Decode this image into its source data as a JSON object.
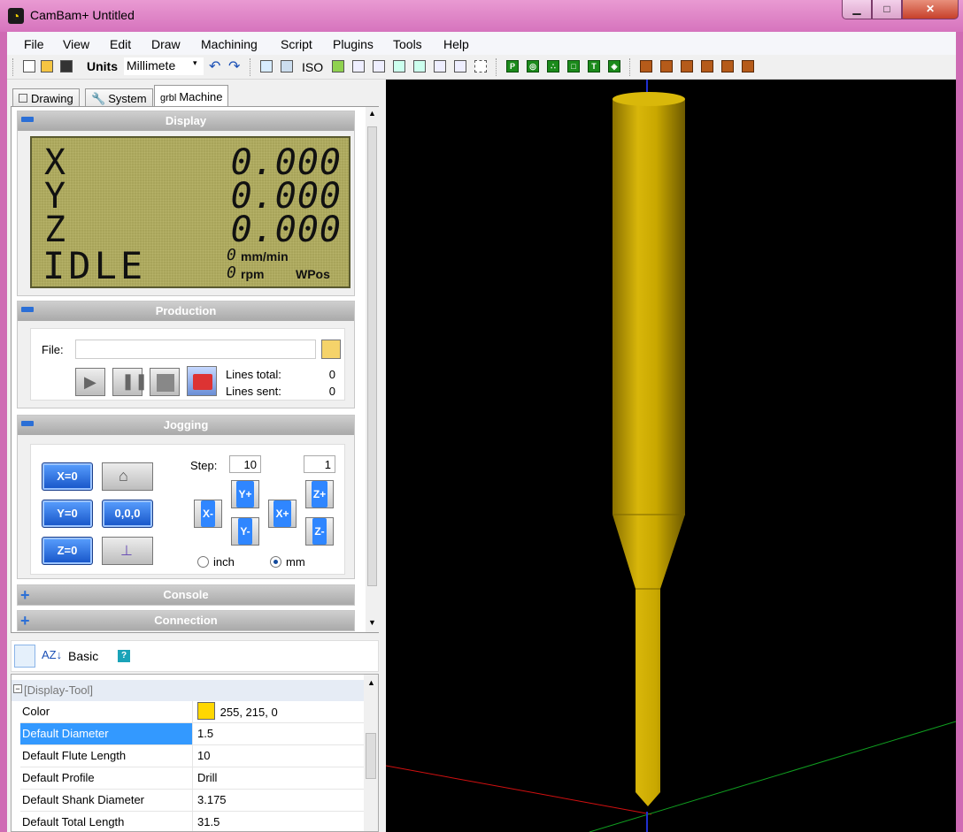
{
  "window": {
    "title": "CamBam+  Untitled",
    "minimize": "▁",
    "maximize": "□",
    "close": "✕"
  },
  "menu": [
    "File",
    "View",
    "Edit",
    "Draw",
    "Machining",
    "Script",
    "Plugins",
    "Tools",
    "Help"
  ],
  "toolbar": {
    "units_label": "Units",
    "units_value": "Millimete",
    "iso_label": "ISO"
  },
  "tabs": [
    {
      "label": "Drawing",
      "icon": "drawing-icon"
    },
    {
      "label": "System",
      "icon": "wrench-icon"
    },
    {
      "label": "Machine",
      "icon": "grbl-icon",
      "prefix": "grbl"
    }
  ],
  "display": {
    "header": "Display",
    "axes": [
      {
        "name": "X",
        "value": "0.000"
      },
      {
        "name": "Y",
        "value": "0.000"
      },
      {
        "name": "Z",
        "value": "0.000"
      }
    ],
    "state": "IDLE",
    "feed_value": "0",
    "feed_unit": "mm/min",
    "rpm_value": "0",
    "rpm_unit": "rpm",
    "coord_mode": "WPos"
  },
  "production": {
    "header": "Production",
    "file_label": "File:",
    "file_value": "",
    "lines_total_label": "Lines total:",
    "lines_total": "0",
    "lines_sent_label": "Lines sent:",
    "lines_sent": "0"
  },
  "jogging": {
    "header": "Jogging",
    "x_zero": "X=0",
    "y_zero": "Y=0",
    "z_zero": "Z=0",
    "all_zero": "0,0,0",
    "step_label": "Step:",
    "step_xy": "10",
    "step_z": "1",
    "x_minus": "X-",
    "x_plus": "X+",
    "y_plus": "Y+",
    "y_minus": "Y-",
    "z_plus": "Z+",
    "z_minus": "Z-",
    "unit_inch": "inch",
    "unit_mm": "mm",
    "selected_unit": "mm"
  },
  "collapsed_sections": [
    "Console",
    "Connection"
  ],
  "property_toolbar": {
    "basic_label": "Basic"
  },
  "property_grid": {
    "category": "[Display-Tool]",
    "rows": [
      {
        "name": "Color",
        "value": "255, 215, 0",
        "swatch": "#ffd700"
      },
      {
        "name": "Default Diameter",
        "value": "1.5",
        "selected": true
      },
      {
        "name": "Default Flute Length",
        "value": "10"
      },
      {
        "name": "Default Profile",
        "value": "Drill"
      },
      {
        "name": "Default Shank Diameter",
        "value": "3.175"
      },
      {
        "name": "Default Total Length",
        "value": "31.5"
      }
    ]
  },
  "colors": {
    "tool": "#c9a800",
    "viewport_bg": "#000000",
    "accent": "#2b6fd6"
  }
}
